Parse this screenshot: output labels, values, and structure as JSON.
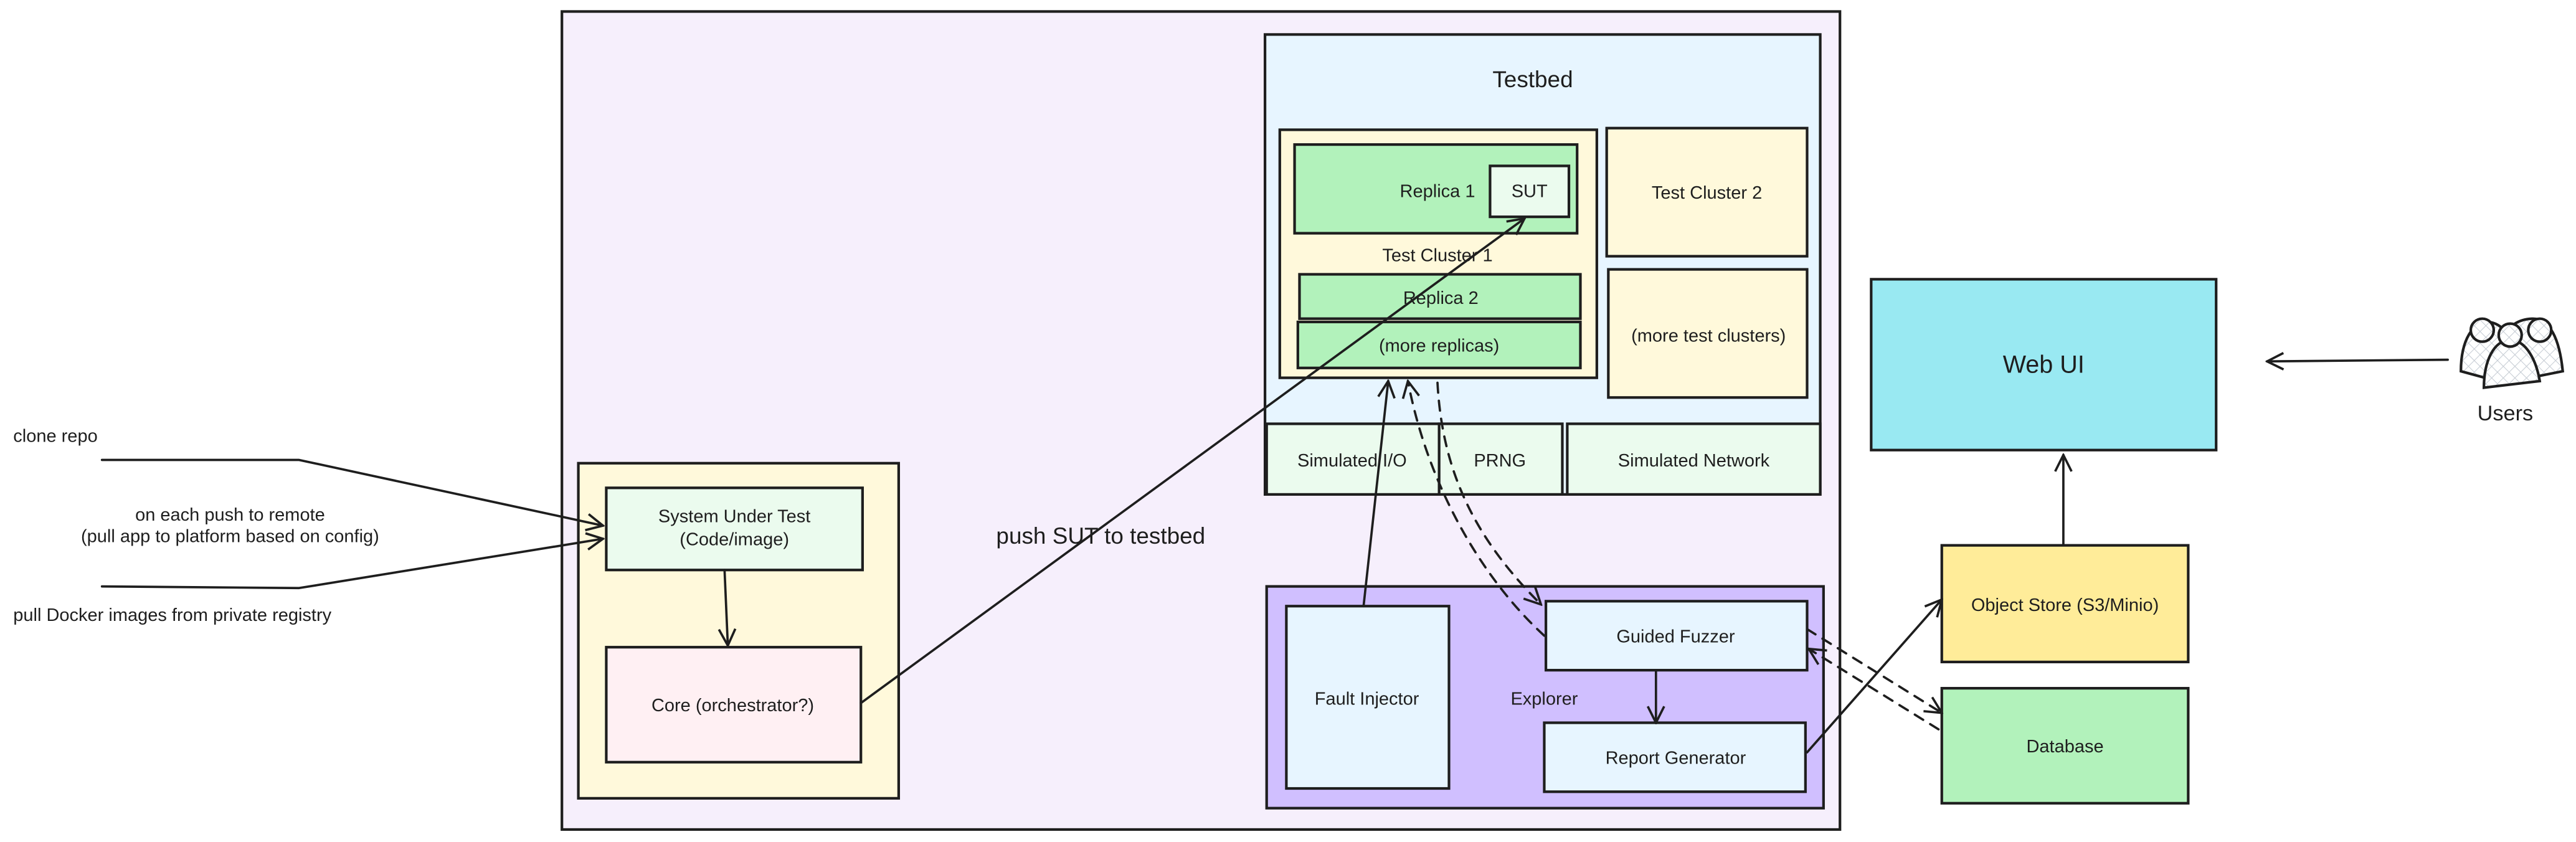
{
  "colors": {
    "platform": "#f6effc",
    "testbed": "#e7f5ff",
    "cluster": "#fff9db",
    "replica": "#b2f2bb",
    "light_green": "#ebfbee",
    "explorer": "#d0bfff",
    "light_blue": "#e7f5ff",
    "core": "#fff0f3",
    "web_ui": "#99e9f2",
    "object_store": "#ffec99",
    "database": "#b2f2bb"
  },
  "inputs": {
    "clone_repo": "clone repo",
    "on_push_line1": "on each push to remote",
    "on_push_line2": "(pull app to platform based on config)",
    "pull_docker": "pull Docker images from private registry"
  },
  "sut_group": {
    "system_under_test_line1": "System Under Test",
    "system_under_test_line2": "(Code/image)",
    "core": "Core (orchestrator?)"
  },
  "push_label": "push SUT to testbed",
  "testbed": {
    "title": "Testbed",
    "cluster1": "Test Cluster 1",
    "replica1": "Replica 1",
    "sut": "SUT",
    "replica2": "Replica 2",
    "more_replicas": "(more replicas)",
    "cluster2": "Test Cluster 2",
    "more_clusters": "(more test clusters)",
    "simulated_io": "Simulated I/O",
    "prng": "PRNG",
    "simulated_network": "Simulated Network"
  },
  "explorer": {
    "label": "Explorer",
    "fault_injector": "Fault Injector",
    "guided_fuzzer": "Guided Fuzzer",
    "report_generator": "Report Generator"
  },
  "external": {
    "web_ui": "Web UI",
    "object_store": "Object Store (S3/Minio)",
    "database": "Database",
    "users": "Users",
    "users_icon": "users-group-icon"
  }
}
